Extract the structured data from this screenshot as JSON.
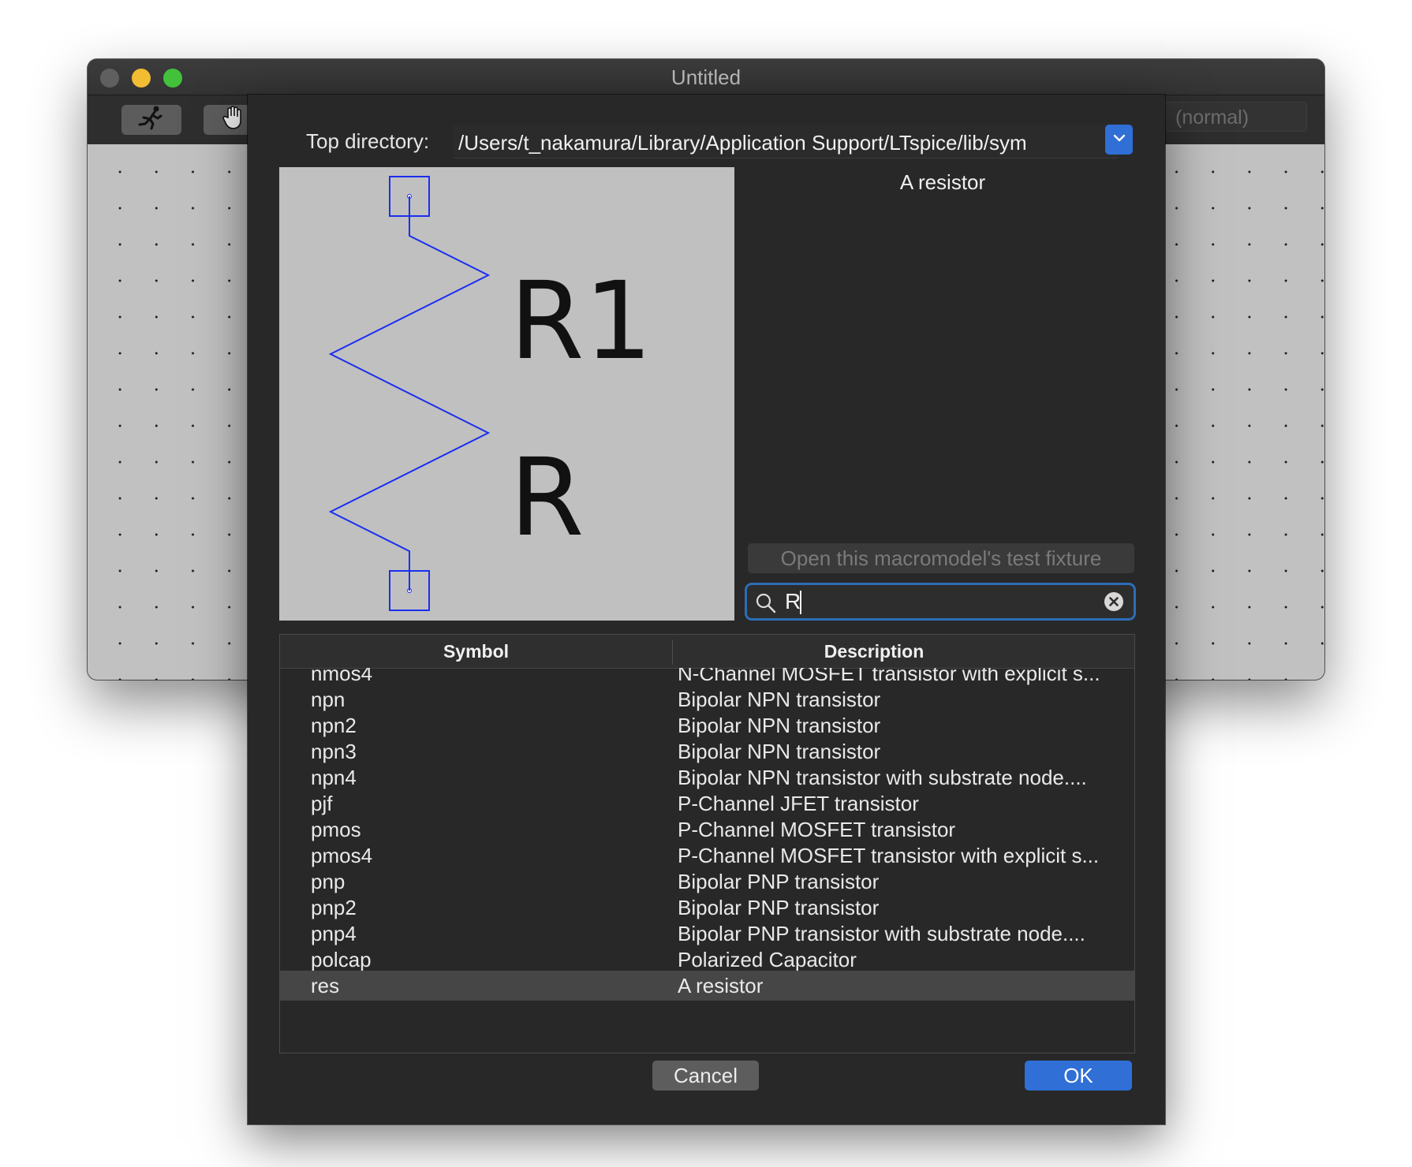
{
  "window": {
    "title": "Untitled",
    "mode_text": "(normal)"
  },
  "dialog": {
    "top_directory_label": "Top directory:",
    "top_directory_value": "/Users/t_nakamura/Library/Application Support/LTspice/lib/sym",
    "selected_description": "A resistor",
    "fixture_button": "Open this macromodel's test fixture",
    "search_value": "R",
    "preview": {
      "instance_name": "R1",
      "value_label": "R"
    },
    "table": {
      "columns": [
        "Symbol",
        "Description"
      ],
      "rows": [
        {
          "symbol": "nmos4",
          "description": "N-Channel MOSFET transistor with explicit s..."
        },
        {
          "symbol": "npn",
          "description": "Bipolar NPN transistor"
        },
        {
          "symbol": "npn2",
          "description": "Bipolar NPN transistor"
        },
        {
          "symbol": "npn3",
          "description": "Bipolar NPN transistor"
        },
        {
          "symbol": "npn4",
          "description": "Bipolar NPN transistor with substrate node...."
        },
        {
          "symbol": "pjf",
          "description": "P-Channel JFET transistor"
        },
        {
          "symbol": "pmos",
          "description": "P-Channel MOSFET transistor"
        },
        {
          "symbol": "pmos4",
          "description": "P-Channel MOSFET transistor with explicit s..."
        },
        {
          "symbol": "pnp",
          "description": "Bipolar PNP transistor"
        },
        {
          "symbol": "pnp2",
          "description": "Bipolar PNP transistor"
        },
        {
          "symbol": "pnp4",
          "description": "Bipolar PNP transistor with substrate node...."
        },
        {
          "symbol": "polcap",
          "description": "Polarized Capacitor"
        },
        {
          "symbol": "res",
          "description": "A resistor"
        }
      ],
      "selected_symbol": "res"
    },
    "buttons": {
      "cancel": "Cancel",
      "ok": "OK"
    }
  },
  "colors": {
    "accent": "#2f6fd6",
    "schematic_wire": "#1a2ff0",
    "dialog_bg": "#282828"
  }
}
